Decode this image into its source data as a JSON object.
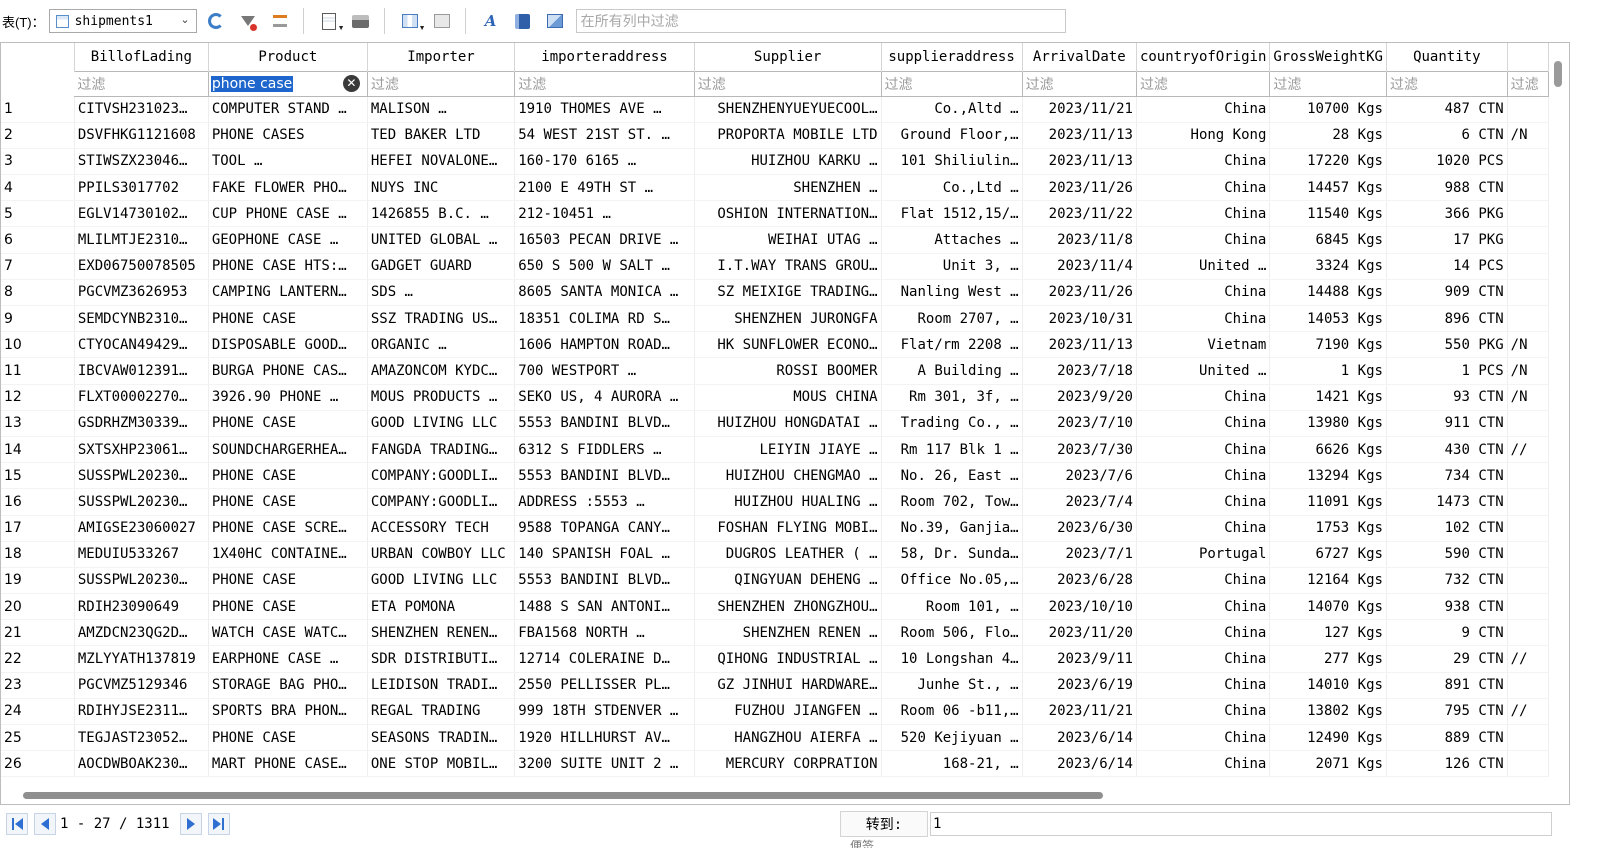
{
  "toolbar": {
    "table_label": "表(T)：",
    "table_name": "shipments1",
    "search_placeholder": "在所有列中过滤",
    "icons": [
      "refresh-icon",
      "clear-filter-icon",
      "clear-sort-icon",
      "new-record-icon",
      "print-icon",
      "insert-record-icon",
      "delete-record-icon",
      "font-icon",
      "bookmark-icon",
      "image-icon"
    ]
  },
  "columns": [
    "BillofLading",
    "Product",
    "Importer",
    "importeraddress",
    "Supplier",
    "supplieraddress",
    "ArrivalDate",
    "countryofOrigin",
    "GrossWeightKG",
    "Quantity",
    ""
  ],
  "filter_placeholder": "过滤",
  "active_filter": {
    "column": 1,
    "value": "phone case"
  },
  "rows": [
    [
      "1",
      "CITVSH231023…",
      "COMPUTER STAND …",
      "MALISON …",
      "1910 THOMES AVE …",
      "SHENZHENYUEYUECOOL…",
      "Co.,Altd …",
      "2023/11/21",
      "China",
      "10700 Kgs",
      "487 CTN",
      ""
    ],
    [
      "2",
      "DSVFHKG1121608",
      "PHONE CASES",
      "TED BAKER LTD",
      "54 WEST 21ST ST. …",
      "PROPORTA MOBILE LTD",
      "Ground Floor,…",
      "2023/11/13",
      "Hong Kong",
      "28 Kgs",
      "6 CTN",
      "/N"
    ],
    [
      "3",
      "STIWSZX23046…",
      "TOOL …",
      "HEFEI NOVALONE…",
      "160-170 6165 …",
      "HUIZHOU KARKU …",
      "101 Shiliulin…",
      "2023/11/13",
      "China",
      "17220 Kgs",
      "1020 PCS",
      ""
    ],
    [
      "4",
      "PPILS3017702",
      "FAKE FLOWER PHO…",
      "NUYS INC",
      "2100 E 49TH ST …",
      "SHENZHEN …",
      "Co.,Ltd …",
      "2023/11/26",
      "China",
      "14457 Kgs",
      "988 CTN",
      ""
    ],
    [
      "5",
      "EGLV14730102…",
      "CUP PHONE CASE …",
      "1426855 B.C. …",
      "212-10451 …",
      "OSHION INTERNATION…",
      "Flat 1512,15/…",
      "2023/11/22",
      "China",
      "11540 Kgs",
      "366 PKG",
      ""
    ],
    [
      "6",
      "MLILMTJE2310…",
      "GEOPHONE CASE …",
      "UNITED GLOBAL …",
      "16503 PECAN DRIVE …",
      "WEIHAI UTAG …",
      "Attaches …",
      "2023/11/8",
      "China",
      "6845 Kgs",
      "17 PKG",
      ""
    ],
    [
      "7",
      "EXD06750078505",
      "PHONE CASE HTS:…",
      "GADGET GUARD",
      "650 S 500 W SALT …",
      "I.T.WAY TRANS GROU…",
      "Unit 3, …",
      "2023/11/4",
      "United …",
      "3324 Kgs",
      "14 PCS",
      ""
    ],
    [
      "8",
      "PGCVMZ3626953",
      "CAMPING LANTERN…",
      "SDS …",
      "8605 SANTA MONICA …",
      "SZ MEIXIGE TRADING…",
      "Nanling West …",
      "2023/11/26",
      "China",
      "14488 Kgs",
      "909 CTN",
      ""
    ],
    [
      "9",
      "SEMDCYNB2310…",
      "PHONE CASE",
      "SSZ TRADING US…",
      "18351 COLIMA RD S…",
      "SHENZHEN JURONGFA",
      "Room 2707, …",
      "2023/10/31",
      "China",
      "14053 Kgs",
      "896 CTN",
      ""
    ],
    [
      "10",
      "CTYOCAN49429…",
      "DISPOSABLE GOOD…",
      "ORGANIC …",
      "1606 HAMPTON ROAD…",
      "HK SUNFLOWER ECONO…",
      "Flat/rm 2208 …",
      "2023/11/13",
      "Vietnam",
      "7190 Kgs",
      "550 PKG",
      "/N"
    ],
    [
      "11",
      "IBCVAW012391…",
      "BURGA PHONE CAS…",
      "AMAZONCOM KYDC…",
      "700 WESTPORT …",
      "ROSSI BOOMER",
      "A Building …",
      "2023/7/18",
      "United …",
      "1 Kgs",
      "1 PCS",
      "/N"
    ],
    [
      "12",
      "FLXT00002270…",
      "3926.90 PHONE …",
      "MOUS PRODUCTS …",
      "SEKO US, 4 AURORA …",
      "MOUS CHINA",
      "Rm 301, 3f, …",
      "2023/9/20",
      "China",
      "1421 Kgs",
      "93 CTN",
      "/N"
    ],
    [
      "13",
      "GSDRHZM30339…",
      "PHONE CASE",
      "GOOD LIVING LLC",
      "5553 BANDINI BLVD…",
      "HUIZHOU HONGDATAI …",
      "Trading Co., …",
      "2023/7/10",
      "China",
      "13980 Kgs",
      "911 CTN",
      ""
    ],
    [
      "14",
      "SXTSXHP23061…",
      "SOUNDCHARGERHEA…",
      "FANGDA TRADING…",
      "6312 S FIDDLERS …",
      "LEIYIN JIAYE …",
      "Rm 117 Blk 1 …",
      "2023/7/30",
      "China",
      "6626 Kgs",
      "430 CTN",
      "//"
    ],
    [
      "15",
      "SUSSPWL20230…",
      "PHONE CASE",
      "COMPANY:GOODLI…",
      "5553 BANDINI BLVD…",
      "HUIZHOU CHENGMAO …",
      "No. 26, East …",
      "2023/7/6",
      "China",
      "13294 Kgs",
      "734 CTN",
      ""
    ],
    [
      "16",
      "SUSSPWL20230…",
      "PHONE CASE",
      "COMPANY:GOODLI…",
      "ADDRESS :5553 …",
      "HUIZHOU HUALING …",
      "Room 702, Tow…",
      "2023/7/4",
      "China",
      "11091 Kgs",
      "1473 CTN",
      ""
    ],
    [
      "17",
      "AMIGSE23060027",
      "PHONE CASE SCRE…",
      "ACCESSORY TECH",
      "9588 TOPANGA CANY…",
      "FOSHAN FLYING MOBI…",
      "No.39, Ganjia…",
      "2023/6/30",
      "China",
      "1753 Kgs",
      "102 CTN",
      ""
    ],
    [
      "18",
      "MEDUIU533267",
      "1X40HC CONTAINE…",
      "URBAN COWBOY LLC",
      "140 SPANISH FOAL …",
      "DUGROS LEATHER ( …",
      "58, Dr. Sunda…",
      "2023/7/1",
      "Portugal",
      "6727 Kgs",
      "590 CTN",
      ""
    ],
    [
      "19",
      "SUSSPWL20230…",
      "PHONE CASE",
      "GOOD LIVING LLC",
      "5553 BANDINI BLVD…",
      "QINGYUAN DEHENG …",
      "Office No.05,…",
      "2023/6/28",
      "China",
      "12164 Kgs",
      "732 CTN",
      ""
    ],
    [
      "20",
      "RDIH23090649",
      "PHONE CASE",
      "ETA POMONA",
      "1488 S SAN ANTONI…",
      "SHENZHEN ZHONGZHOU…",
      "Room 101, …",
      "2023/10/10",
      "China",
      "14070 Kgs",
      "938 CTN",
      ""
    ],
    [
      "21",
      "AMZDCN23QG2D…",
      "WATCH CASE WATC…",
      "SHENZHEN RENEN…",
      "FBA1568 NORTH …",
      "SHENZHEN RENEN …",
      "Room 506, Flo…",
      "2023/11/20",
      "China",
      "127 Kgs",
      "9 CTN",
      ""
    ],
    [
      "22",
      "MZLYYATH137819",
      "EARPHONE CASE …",
      "SDR DISTRIBUTI…",
      "12714 COLERAINE D…",
      "QIHONG INDUSTRIAL …",
      "10 Longshan 4…",
      "2023/9/11",
      "China",
      "277 Kgs",
      "29 CTN",
      "//"
    ],
    [
      "23",
      "PGCVMZ5129346",
      "STORAGE BAG PHO…",
      "LEIDISON TRADI…",
      "2550 PELLISSER PL…",
      "GZ JINHUI HARDWARE…",
      "Junhe St., …",
      "2023/6/19",
      "China",
      "14010 Kgs",
      "891 CTN",
      ""
    ],
    [
      "24",
      "RDIHYJSE2311…",
      "SPORTS BRA PHON…",
      "REGAL TRADING",
      "999 18TH STDENVER …",
      "FUZHOU JIANGFEN …",
      "Room 06 -b11,…",
      "2023/11/21",
      "China",
      "13802 Kgs",
      "795 CTN",
      "//"
    ],
    [
      "25",
      "TEGJAST23052…",
      "PHONE CASE",
      "SEASONS TRADIN…",
      "1920 HILLHURST AV…",
      "HANGZHOU AIERFA …",
      "520 Kejiyuan …",
      "2023/6/14",
      "China",
      "12490 Kgs",
      "889 CTN",
      ""
    ],
    [
      "26",
      "AOCDWBOAK230…",
      "MART PHONE CASE…",
      "ONE STOP MOBIL…",
      "3200 SUITE UNIT 2 …",
      "MERCURY CORPRATION",
      "168-21, …",
      "2023/6/14",
      "China",
      "2071 Kgs",
      "126 CTN",
      ""
    ]
  ],
  "footer": {
    "page_info": "1 - 27 / 1311",
    "goto_label": "转到:",
    "goto_value": "1",
    "bottom_hint": "便签"
  }
}
